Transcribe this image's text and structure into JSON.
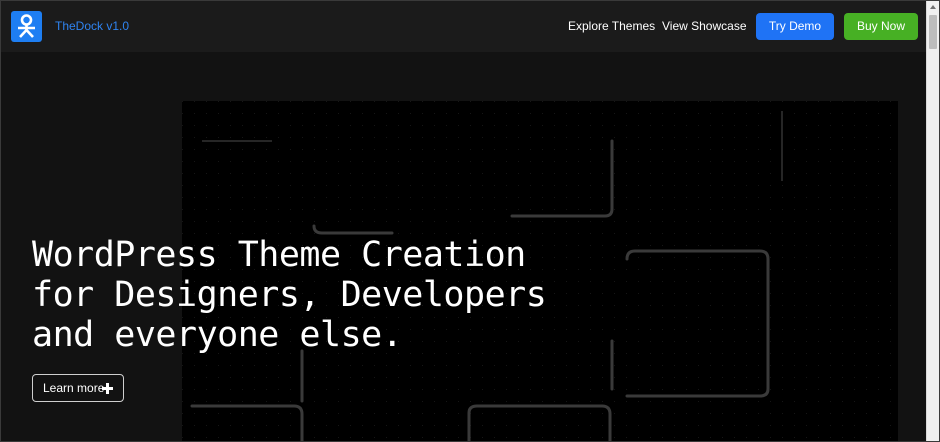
{
  "brand": {
    "name": "TheDock v1.0",
    "logo_icon": "person-icon",
    "logo_color": "#1e7ef2"
  },
  "nav": {
    "links": [
      "Explore Themes",
      "View Showcase"
    ],
    "try_demo": "Try Demo",
    "buy_now": "Buy Now",
    "try_demo_color": "#1f73f5",
    "buy_now_color": "#47b024"
  },
  "hero": {
    "headline_lines": [
      "WordPress Theme Creation",
      "for Designers, Developers",
      "and everyone else."
    ],
    "cta_label": "Learn more",
    "cta_icon": "plus-icon"
  }
}
